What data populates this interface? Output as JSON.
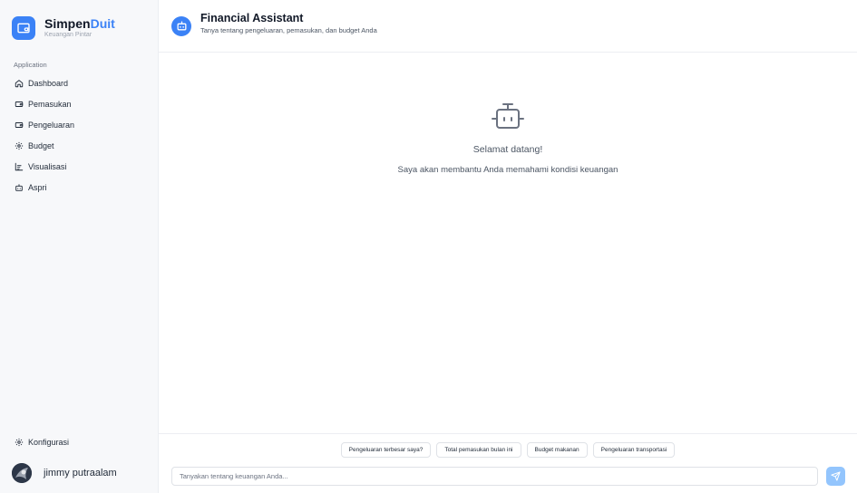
{
  "brand": {
    "name_main": "Simpen",
    "name_accent": "Duit",
    "tagline": "Keuangan Pintar"
  },
  "sidebar": {
    "section_label": "Application",
    "items": [
      {
        "label": "Dashboard",
        "icon": "home-icon"
      },
      {
        "label": "Pemasukan",
        "icon": "wallet-icon"
      },
      {
        "label": "Pengeluaran",
        "icon": "wallet-icon"
      },
      {
        "label": "Budget",
        "icon": "settings-icon"
      },
      {
        "label": "Visualisasi",
        "icon": "chart-icon"
      },
      {
        "label": "Aspri",
        "icon": "bot-icon"
      }
    ],
    "config_label": "Konfigurasi",
    "user_name": "jimmy putraalam"
  },
  "header": {
    "title": "Financial Assistant",
    "subtitle": "Tanya tentang pengeluaran, pemasukan, dan budget Anda"
  },
  "welcome": {
    "title": "Selamat datang!",
    "subtitle": "Saya akan membantu Anda memahami kondisi keuangan"
  },
  "suggestions": [
    "Pengeluaran terbesar saya?",
    "Total pemasukan bulan ini",
    "Budget makanan",
    "Pengeluaran transportasi"
  ],
  "chat": {
    "placeholder": "Tanyakan tentang keuangan Anda..."
  },
  "colors": {
    "accent": "#3b82f6",
    "send_button": "#93c5fd",
    "sidebar_bg": "#f7f8fa"
  }
}
